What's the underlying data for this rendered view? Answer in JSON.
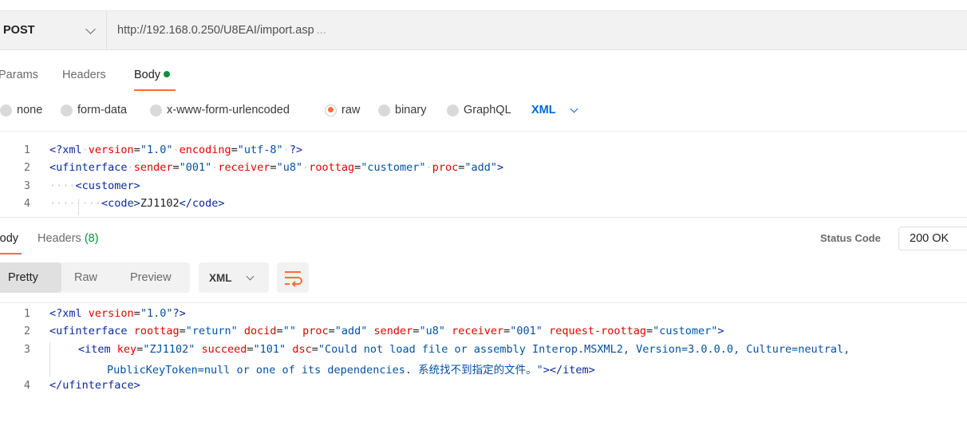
{
  "request": {
    "method": "POST",
    "url": "http://192.168.0.250/U8EAI/import.asp",
    "url_ellipsis": "..."
  },
  "request_tabs": {
    "params": "Params",
    "headers": "Headers",
    "body": "Body"
  },
  "body_types": {
    "none": "none",
    "form_data": "form-data",
    "urlencoded": "x-www-form-urlencoded",
    "raw": "raw",
    "binary": "binary",
    "graphql": "GraphQL",
    "language": "XML",
    "selected": "raw"
  },
  "request_body": {
    "line_numbers": [
      "1",
      "2",
      "3",
      "4"
    ],
    "line1": {
      "pi_open": "<?xml",
      "attr1": "version",
      "val1": "\"1.0\"",
      "attr2": "encoding",
      "val2": "\"utf-8\"",
      "pi_close": "?>"
    },
    "line2": {
      "open": "<ufinterface",
      "a1": "sender",
      "v1": "\"001\"",
      "a2": "receiver",
      "v2": "\"u8\"",
      "a3": "roottag",
      "v3": "\"customer\"",
      "a4": "proc",
      "v4": "\"add\"",
      "close": ">"
    },
    "line3": {
      "indent": "····",
      "tag": "<customer>"
    },
    "line4": {
      "indent": "········",
      "open": "<code>",
      "text": "ZJ1102",
      "close": "</code>"
    }
  },
  "response_tabs": {
    "body": "Body",
    "headers": "Headers",
    "headers_count": "(8)"
  },
  "status": {
    "label": "Status Code",
    "value": "200 OK"
  },
  "response_view": {
    "pretty": "Pretty",
    "raw": "Raw",
    "preview": "Preview",
    "format": "XML"
  },
  "response_body": {
    "line_numbers": [
      "1",
      "2",
      "3",
      "4"
    ],
    "line1": {
      "pi_open": "<?xml",
      "attr1": "version",
      "val1": "\"1.0\"",
      "pi_close": "?>"
    },
    "line2": {
      "open": "<ufinterface",
      "a1": "roottag",
      "v1": "\"return\"",
      "a2": "docid",
      "v2": "\"\"",
      "a3": "proc",
      "v3": "\"add\"",
      "a4": "sender",
      "v4": "\"u8\"",
      "a5": "receiver",
      "v5": "\"001\"",
      "a6": "request-roottag",
      "v6": "\"customer\"",
      "close": ">"
    },
    "line3": {
      "open": "<item",
      "a1": "key",
      "v1": "\"ZJ1102\"",
      "a2": "succeed",
      "v2": "\"101\"",
      "a3": "dsc",
      "v3a": "\"Could not load file or assembly Interop.MSXML2, Version=3.0.0.0, Culture=neutral,",
      "v3b": "PublicKeyToken=null or one of its dependencies. 系统找不到指定的文件。\"",
      "close": "></item>"
    },
    "line4": {
      "tag": "</ufinterface>"
    }
  },
  "colors": {
    "accent": "#ff6c37",
    "active_dot": "#0c8e3a",
    "link_blue": "#0265d2"
  }
}
